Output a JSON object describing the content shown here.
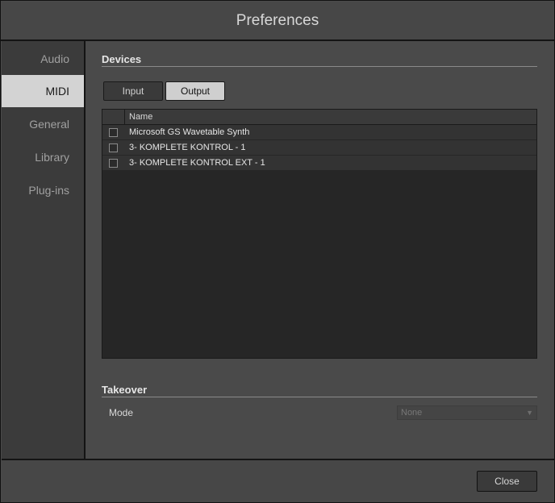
{
  "window": {
    "title": "Preferences"
  },
  "sidebar": {
    "items": [
      {
        "label": "Audio"
      },
      {
        "label": "MIDI"
      },
      {
        "label": "General"
      },
      {
        "label": "Library"
      },
      {
        "label": "Plug-ins"
      }
    ],
    "active": "MIDI"
  },
  "devices": {
    "section_title": "Devices",
    "tabs": {
      "input_label": "Input",
      "output_label": "Output",
      "selected": "Output"
    },
    "table": {
      "column_header": "Name",
      "rows": [
        {
          "name": "Microsoft GS Wavetable Synth",
          "checked": false
        },
        {
          "name": "3- KOMPLETE KONTROL - 1",
          "checked": false
        },
        {
          "name": "3- KOMPLETE KONTROL EXT - 1",
          "checked": false
        }
      ]
    }
  },
  "takeover": {
    "section_title": "Takeover",
    "mode_label": "Mode",
    "mode_value": "None"
  },
  "footer": {
    "close_label": "Close"
  },
  "colors": {
    "background": "#4a4a4a",
    "sidebar_background": "#3b3b3b",
    "active_tab": "#d3d3d3",
    "table_background": "#262626",
    "row_background": "#333333"
  },
  "icons": {
    "row_checkbox": "checkbox-icon",
    "dropdown": "chevron-down-icon"
  }
}
